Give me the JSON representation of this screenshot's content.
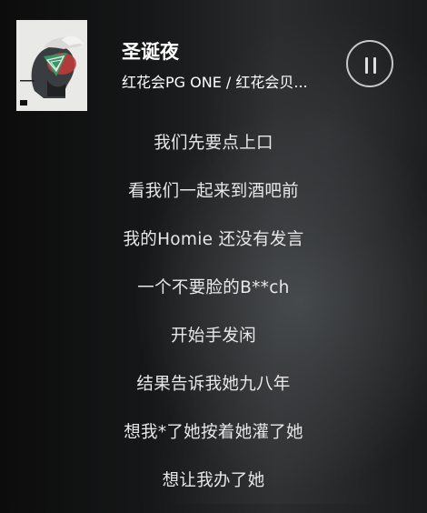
{
  "now_playing": {
    "title": "圣诞夜",
    "artist": "红花会PG ONE / 红花会贝...",
    "playback_state": "playing",
    "album_art_icon": "album-cover-icon",
    "pause_icon": "pause-icon"
  },
  "lyrics": [
    "我们先要点上口",
    "看我们一起来到酒吧前",
    "我的Homie 还没有发言",
    "一个不要脸的B**ch",
    "开始手发闲",
    "结果告诉我她九八年",
    "想我*了她按着她灌了她",
    "想让我办了她"
  ],
  "colors": {
    "text": "#ffffff",
    "lyric_text": "#e8e8e8",
    "album_background": "#e9e9e7",
    "album_accent_green": "#2fa06a",
    "album_accent_red": "#c73b3b"
  }
}
